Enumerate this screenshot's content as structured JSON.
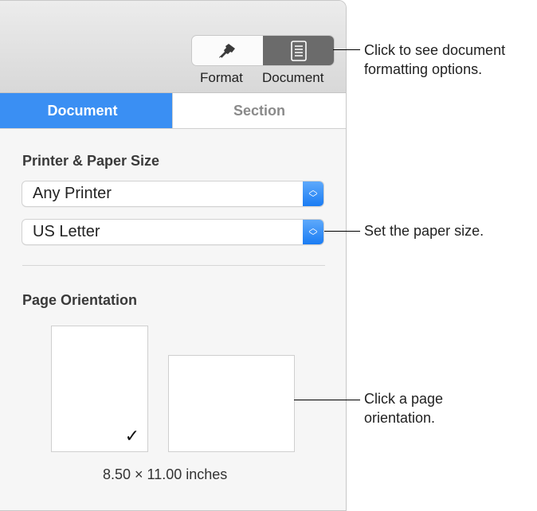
{
  "toolbar": {
    "format_label": "Format",
    "document_label": "Document"
  },
  "tabs": [
    {
      "label": "Document",
      "active": true
    },
    {
      "label": "Section",
      "active": false
    }
  ],
  "printer_section": {
    "heading": "Printer & Paper Size",
    "printer_value": "Any Printer",
    "paper_value": "US Letter"
  },
  "orientation_section": {
    "heading": "Page Orientation",
    "selected": "portrait",
    "dimensions": "8.50 × 11.00 inches",
    "checkmark": "✓"
  },
  "callouts": {
    "document": "Click to see document formatting options.",
    "document_l1": "Click to see document",
    "document_l2": "formatting options.",
    "paper": "Set the paper size.",
    "orientation_l1": "Click a page",
    "orientation_l2": "orientation."
  },
  "colors": {
    "accent": "#3a8ff3",
    "segment_selected": "#6b6b6b"
  }
}
